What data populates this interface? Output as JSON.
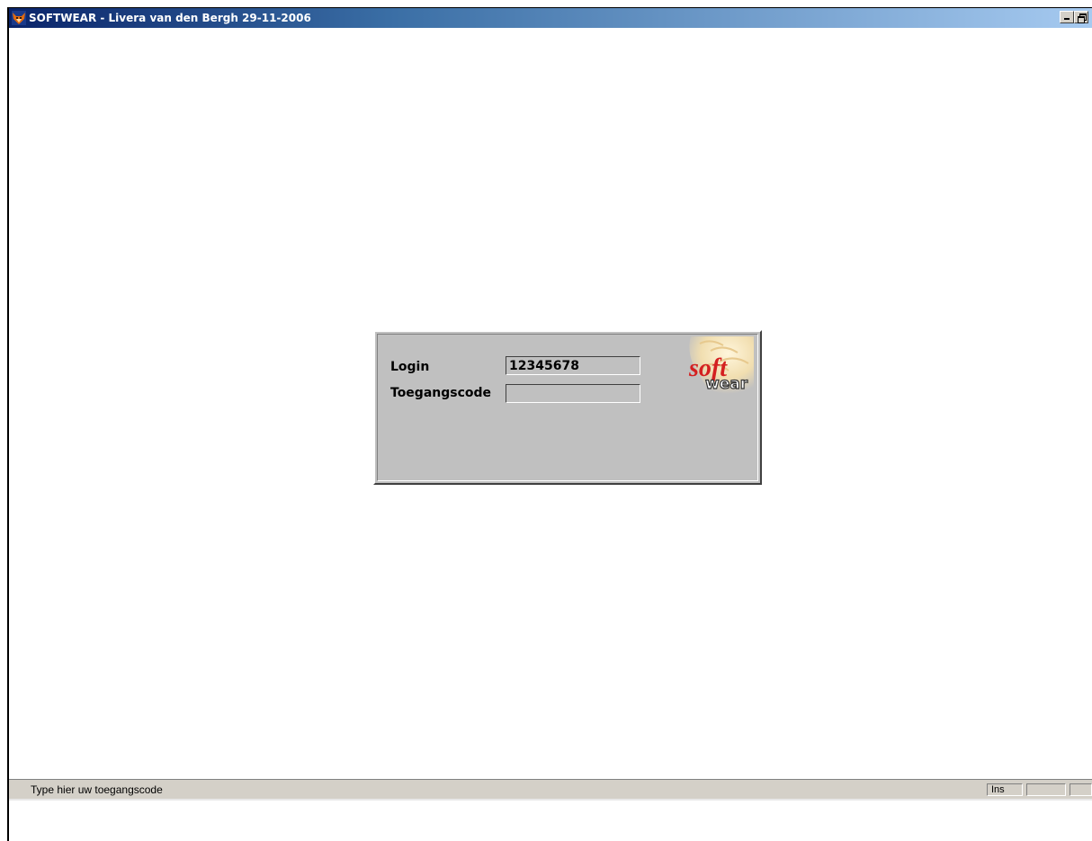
{
  "window": {
    "title": "SOFTWEAR - Livera van den Bergh 29-11-2006",
    "icon": "fox-app-icon",
    "minimize_label": "minimize",
    "restore_label": "restore"
  },
  "login_dialog": {
    "login_label": "Login",
    "login_value": "12345678",
    "access_code_label": "Toegangscode",
    "access_code_value": "",
    "logo_text_top": "soft",
    "logo_text_bottom": "wear",
    "logo_accent": "#d42020"
  },
  "statusbar": {
    "message": "Type hier uw toegangscode",
    "ins_indicator": "Ins"
  },
  "colors": {
    "title_start": "#0a246a",
    "title_end": "#a6caf0",
    "dialog_bg": "#c0c0c0"
  }
}
